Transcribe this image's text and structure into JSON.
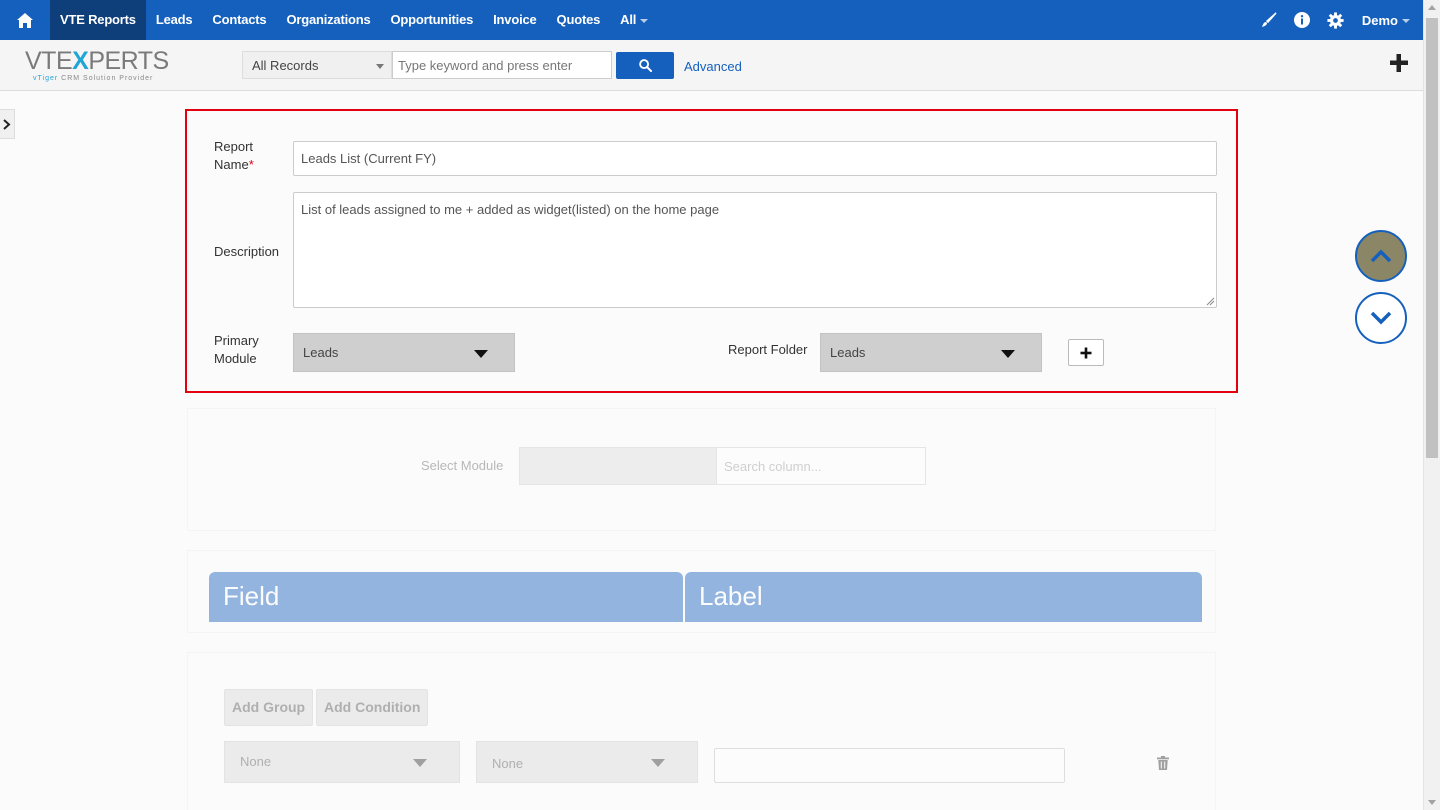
{
  "topnav": {
    "items": [
      {
        "label": "VTE Reports",
        "active": true
      },
      {
        "label": "Leads"
      },
      {
        "label": "Contacts"
      },
      {
        "label": "Organizations"
      },
      {
        "label": "Opportunities"
      },
      {
        "label": "Invoice"
      },
      {
        "label": "Quotes"
      },
      {
        "label": "All"
      }
    ],
    "user": "Demo",
    "icons": [
      "home-icon",
      "brush-icon",
      "info-icon",
      "gear-icon"
    ],
    "bg_color": "#1560bd"
  },
  "header": {
    "logo_word_left": "VTE",
    "logo_word_x": "X",
    "logo_word_right": "PERTS",
    "logo_tag_vt": "vTiger",
    "logo_tag_rest": "CRM Solution Provider",
    "records_select": "All Records",
    "search_placeholder": "Type keyword and press enter",
    "advanced_link": "Advanced"
  },
  "report_form": {
    "name_label_1": "Report",
    "name_label_2": "Name",
    "name_required": "*",
    "name_value": "Leads List (Current FY)",
    "description_label": "Description",
    "description_value": "List of leads assigned to me + added as widget(listed) on the home page",
    "primary_module_label_1": "Primary",
    "primary_module_label_2": "Module",
    "primary_module_value": "Leads",
    "report_folder_label": "Report Folder",
    "report_folder_value": "Leads",
    "highlight_color": "#e3000f"
  },
  "columns_panel": {
    "select_module_label": "Select Module",
    "search_placeholder": "Search column..."
  },
  "fields_table": {
    "headers": [
      "Field",
      "Label"
    ]
  },
  "conditions": {
    "add_group": "Add Group",
    "add_condition": "Add Condition",
    "field_select": "None",
    "operator_select": "None"
  }
}
